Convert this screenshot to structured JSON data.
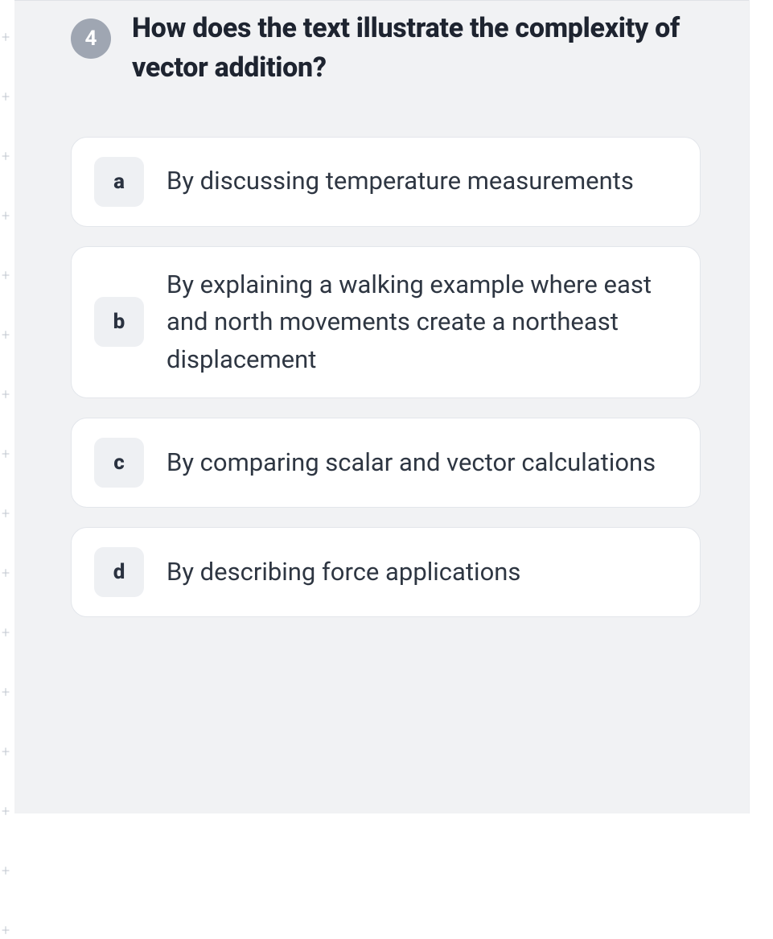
{
  "question": {
    "number": "4",
    "text": "How does the text illustrate the complexity of vector addition?"
  },
  "options": [
    {
      "letter": "a",
      "text": "By discussing temperature measurements"
    },
    {
      "letter": "b",
      "text": "By explaining a walking example where east and north movements create a northeast displacement"
    },
    {
      "letter": "c",
      "text": "By comparing scalar and vector calculations"
    },
    {
      "letter": "d",
      "text": "By describing force applications"
    }
  ],
  "rail_marks": [
    "+",
    "+",
    "+",
    "+",
    "+",
    "+",
    "+",
    "+",
    "+",
    "+",
    "+",
    "+",
    "+",
    "+",
    "+",
    "+"
  ]
}
